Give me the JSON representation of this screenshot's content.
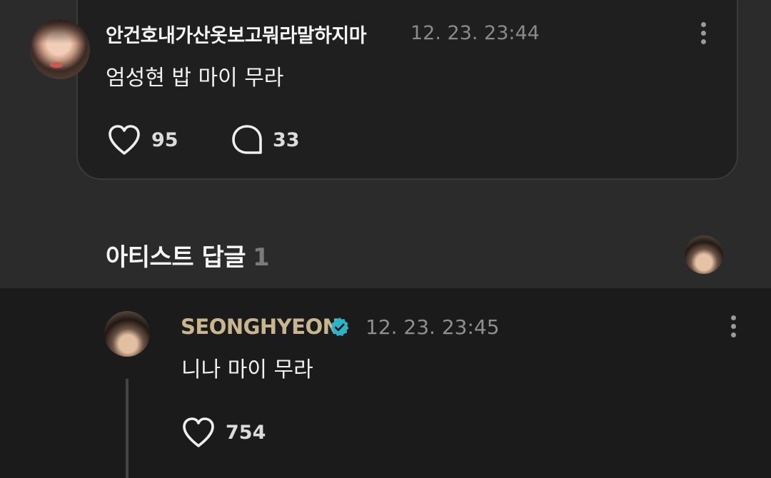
{
  "post": {
    "author": "안건호내가산옷보고뭐라말하지마",
    "time": "12. 23. 23:44",
    "body": "엄성현 밥 마이 무라",
    "likes": "95",
    "comments": "33"
  },
  "section": {
    "title": "아티스트 답글",
    "count": "1"
  },
  "reply": {
    "author": "SEONGHYEON",
    "time": "12. 23. 23:45",
    "body": "니나 마이 무라",
    "likes": "754"
  },
  "colors": {
    "background": "#2b2b2b",
    "card": "#1f1f1f",
    "reply_background": "#1b1b1b",
    "artist_name": "#c8b68f",
    "verified": "#2bb3c9",
    "muted_text": "#8a8a8a"
  },
  "icons": [
    "heart-icon",
    "comment-bubble-icon",
    "more-vertical-icon",
    "verified-badge-icon"
  ]
}
